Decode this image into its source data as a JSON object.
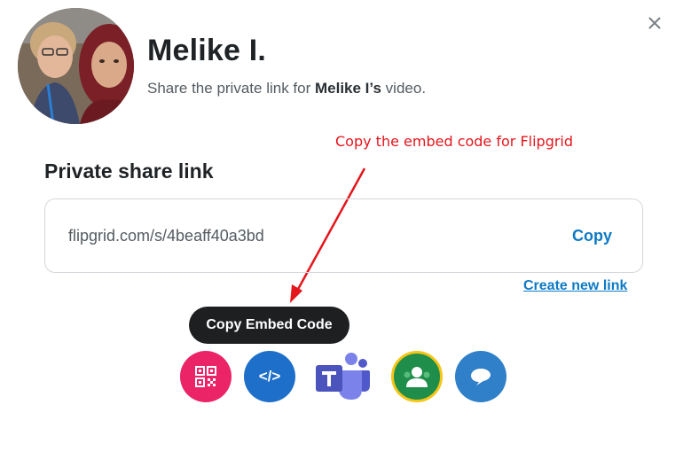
{
  "header": {
    "user_name": "Melike I.",
    "subtitle_prefix": "Share the private link for ",
    "subtitle_name": "Melike I’s",
    "subtitle_suffix": " video."
  },
  "annotation": {
    "text": "Copy the embed code for Flipgrid",
    "color": "#e4151b"
  },
  "share_link": {
    "section_title": "Private share link",
    "url": "flipgrid.com/s/4beaff40a3bd",
    "copy_label": "Copy",
    "create_new_label": "Create new link"
  },
  "tooltip": {
    "text": "Copy Embed Code"
  },
  "share_options": [
    {
      "name": "qr-code",
      "icon": "qr-code-icon",
      "color": "#ea2466"
    },
    {
      "name": "embed",
      "icon": "code-icon",
      "glyph": "</>",
      "color": "#1d6fc9"
    },
    {
      "name": "microsoft-teams",
      "icon": "teams-icon",
      "color": "#4b53bc"
    },
    {
      "name": "google-classroom",
      "icon": "classroom-icon",
      "color": "#1f8e4a"
    },
    {
      "name": "remind",
      "icon": "remind-icon",
      "color": "#2f80c9"
    }
  ],
  "colors": {
    "accent": "#0e7ac4",
    "tooltip_bg": "#1d1f21"
  }
}
